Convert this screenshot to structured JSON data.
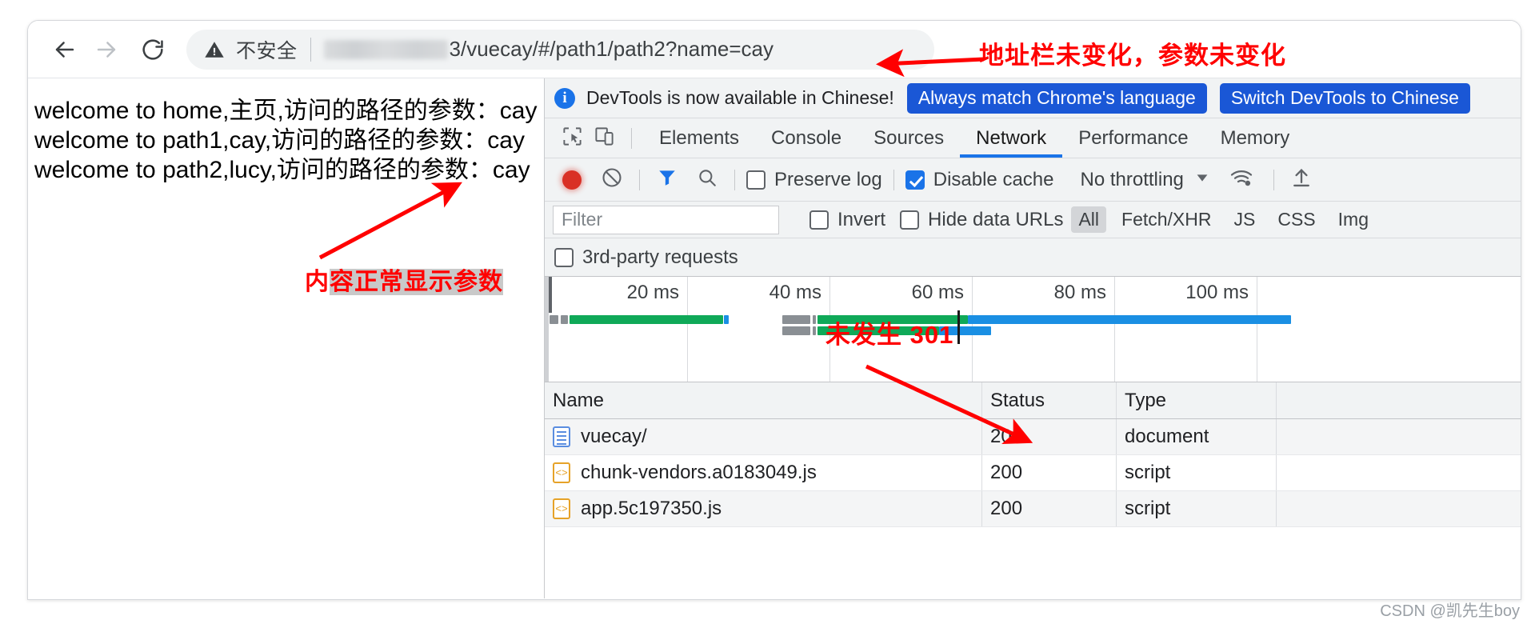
{
  "browser": {
    "nav": {
      "back_icon": "arrow-left-icon",
      "forward_icon": "arrow-right-icon",
      "reload_icon": "reload-icon"
    },
    "omnibox": {
      "security_icon": "warning-triangle-icon",
      "security_label": "不安全",
      "url_redacted": true,
      "url": "3/vuecay/#/path1/path2?name=cay"
    }
  },
  "annotations": {
    "address_bar": "地址栏未变化，参数未变化",
    "content_prefix": "内",
    "content_highlight": "容正常显示参数",
    "no_301": "未发生 301"
  },
  "page": {
    "lines": [
      "welcome to home,主页,访问的路径的参数：cay",
      "welcome to path1,cay,访问的路径的参数：cay",
      "welcome to path2,lucy,访问的路径的参数：cay"
    ]
  },
  "devtools": {
    "banner": {
      "info_icon": "info-icon",
      "message": "DevTools is now available in Chinese!",
      "primary_button": "Always match Chrome's language",
      "secondary_button": "Switch DevTools to Chinese"
    },
    "toolbar_icons": {
      "inspect": "inspect-element-icon",
      "device": "device-toolbar-icon"
    },
    "tabs": [
      {
        "label": "Elements",
        "active": false
      },
      {
        "label": "Console",
        "active": false
      },
      {
        "label": "Sources",
        "active": false
      },
      {
        "label": "Network",
        "active": true
      },
      {
        "label": "Performance",
        "active": false
      },
      {
        "label": "Memory",
        "active": false
      }
    ],
    "network_toolbar": {
      "record_icon": "record-button-icon",
      "clear_icon": "clear-network-log-icon",
      "filter_icon": "filter-funnel-icon",
      "search_icon": "search-icon",
      "preserve_log_label": "Preserve log",
      "preserve_log_checked": false,
      "disable_cache_label": "Disable cache",
      "disable_cache_checked": true,
      "throttling_label": "No throttling",
      "throttling_caret": "chevron-down-icon",
      "network_conditions_icon": "wifi-settings-icon",
      "import_icon": "import-har-icon"
    },
    "filter_bar": {
      "filter_placeholder": "Filter",
      "filter_value": "",
      "invert_label": "Invert",
      "invert_checked": false,
      "hide_data_urls_label": "Hide data URLs",
      "hide_data_urls_checked": false,
      "types": [
        {
          "label": "All",
          "selected": true
        },
        {
          "label": "Fetch/XHR",
          "selected": false
        },
        {
          "label": "JS",
          "selected": false
        },
        {
          "label": "CSS",
          "selected": false
        },
        {
          "label": "Img",
          "selected": false
        }
      ],
      "third_party_label": "3rd-party requests",
      "third_party_checked": false
    },
    "overview": {
      "ticks": [
        "20 ms",
        "40 ms",
        "60 ms",
        "80 ms",
        "100 ms"
      ]
    },
    "table": {
      "columns": [
        "Name",
        "Status",
        "Type"
      ],
      "rows": [
        {
          "name": "vuecay/",
          "status": "200",
          "type": "document",
          "icon": "document-file-icon"
        },
        {
          "name": "chunk-vendors.a0183049.js",
          "status": "200",
          "type": "script",
          "icon": "script-file-icon"
        },
        {
          "name": "app.5c197350.js",
          "status": "200",
          "type": "script",
          "icon": "script-file-icon"
        }
      ]
    }
  },
  "watermark": "CSDN @凯先生boy",
  "colors": {
    "accent": "#1a73e8",
    "annotation": "#ff0000",
    "record": "#d93025",
    "bar_green": "#0fa958",
    "bar_blue": "#1a8fe3",
    "bar_gray": "#8a8f94"
  }
}
